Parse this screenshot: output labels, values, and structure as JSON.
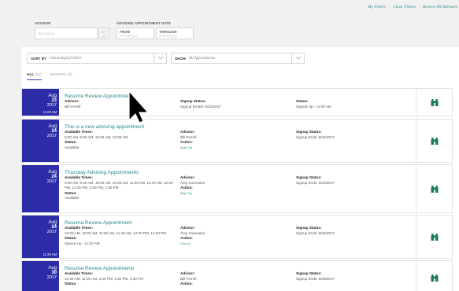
{
  "topnav": [
    "My Filters",
    "Clear Filters",
    "Review All Advisors"
  ],
  "filters": {
    "advisor_label": "ADVISOR",
    "advisor_placeholder": "Start typing...",
    "all_button": "See All",
    "date_label": "ADVISING APPOINTMENT DATE",
    "from_label": "FROM",
    "from_placeholder": "mm-dd-yyyy",
    "through_label": "THROUGH",
    "through_placeholder": "mm-dd-yyyy"
  },
  "sort": {
    "label": "SORT BY",
    "value": "Chronological Order"
  },
  "show": {
    "label": "SHOW",
    "value": "All Appointments"
  },
  "tabs": {
    "all": "ALL",
    "all_count": "(11)",
    "signups": "SIGNUPS",
    "signups_count": "(3)"
  },
  "cards": [
    {
      "month": "Aug",
      "day": "23",
      "year": "2017",
      "time": "11:00 AM",
      "title": "Resume Review Appointment",
      "c1_label": "Advisor:",
      "c1_val": "Bill Ferrell",
      "c2_label": "Signup Status:",
      "c2_val": "Signup Ended: 8/22/2017",
      "c3_label": "Status:",
      "c3_val": "Signed Up - 11:00 AM"
    },
    {
      "month": "Aug",
      "day": "24",
      "year": "2017",
      "time": "",
      "title": "This is a new advising appointment",
      "c1_label": "Available Times:",
      "c1_val": "9:00 AM, 9:30 AM, 10:00 AM, 10:30 AM",
      "c1b_label": "Status:",
      "c1b_val": "Available",
      "c2_label": "Advisor:",
      "c2_val": "Bill Ferrell",
      "c2b_label": "Action:",
      "c2b_val": "Sign Up",
      "c3_label": "Signup Status:",
      "c3_val": "Signup Ends: 8/23/2017"
    },
    {
      "month": "Aug",
      "day": "24",
      "year": "2017",
      "time": "",
      "title": "Thursday Advising Appointments",
      "c1_label": "Available Times:",
      "c1_val": "9:00 AM, 9:30 AM, 10:00 AM, 10:30 AM, 11:00 AM, 11:30 AM, 12:00 PM, 12:30 PM, 1:00 PM, 1:30 PM",
      "c1b_label": "Status:",
      "c1b_val": "Available",
      "c2_label": "Advisor:",
      "c2_val": "Amy Counselor",
      "c2b_label": "Action:",
      "c2b_val": "Sign Up",
      "c3_label": "Signup Status:",
      "c3_val": "Signup Ends: 8/23/2017"
    },
    {
      "month": "Aug",
      "day": "24",
      "year": "2017",
      "time": "11:20 AM",
      "title": "Resume Review Appointment",
      "c1_label": "Available Times:",
      "c1_val": "10:00 AM, 10:20 AM, 11:00 AM, 11:40 AM, 12:00 PM, 12:20 PM",
      "c1b_label": "Status:",
      "c1b_val": "Signed Up - 11:20 AM",
      "c2_label": "Advisor:",
      "c2_val": "Amy Counselor",
      "c2b_label": "Action:",
      "c2b_val": "Cancel",
      "c3_label": "Signup Status:",
      "c3_val": "Signup Ends: 8/23/2017"
    },
    {
      "month": "Aug",
      "day": "30",
      "year": "2017",
      "time": "",
      "title": "Resume Review Appointments",
      "c1_label": "Available Times:",
      "c1_val": "10:30 AM, 11:00 AM, 1:00 PM, 1:30 PM, 2:30 PM",
      "c1b_label": "Status:",
      "c1b_val": "",
      "c2_label": "Advisor:",
      "c2_val": "Bill Ferrell",
      "c2b_label": "Action:",
      "c2b_val": "",
      "c3_label": "Signup Status:",
      "c3_val": "Signup Ends: 8/29/2017"
    }
  ],
  "colors": {
    "accent": "#2a8a8a",
    "date_block": "#2c2ca8"
  },
  "icons": {
    "view": "binoculars-icon",
    "cursor": "mouse-pointer-icon"
  }
}
